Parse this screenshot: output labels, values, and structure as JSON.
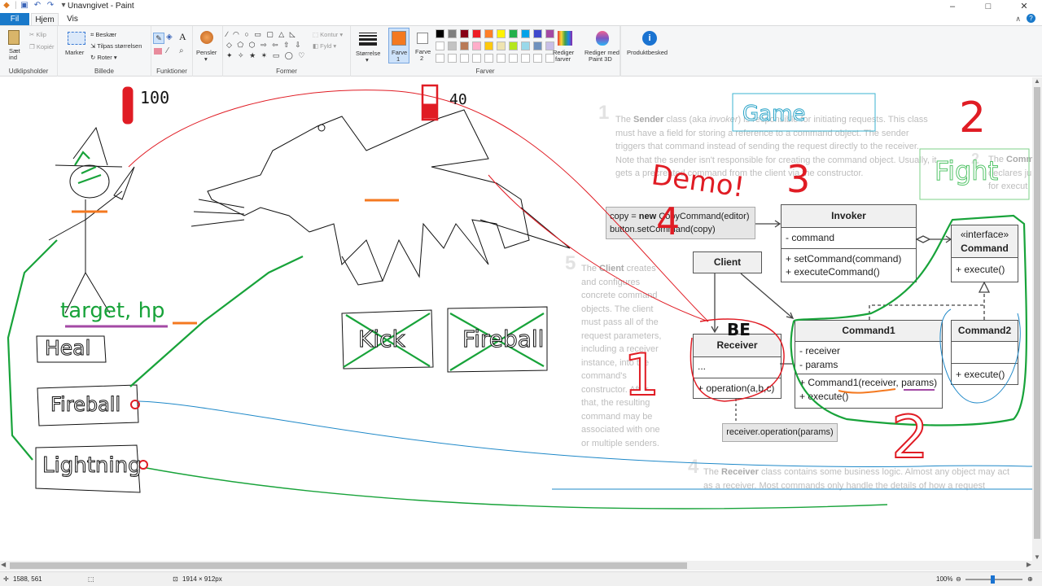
{
  "window": {
    "title": "Unavngivet - Paint",
    "minimize": "–",
    "maximize": "□",
    "close": "✕"
  },
  "tabs": [
    "Fil",
    "Hjem",
    "Vis"
  ],
  "ribbon": {
    "clipboard": {
      "paste": "Sæt",
      "paste2": "ind",
      "cut": "Klip",
      "copy": "Kopiér",
      "label": "Udklipsholder"
    },
    "image": {
      "select": "Marker",
      "crop": "Beskær",
      "resize": "Tilpas størrelsen",
      "rotate": "Roter",
      "label": "Billede"
    },
    "tools": {
      "label": "Funktioner"
    },
    "brushes": {
      "label": "Pensler"
    },
    "shapes": {
      "outline": "Kontur",
      "fill": "Fyld",
      "label": "Former"
    },
    "size": {
      "label": "Størrelse"
    },
    "color1": {
      "label": "Farve",
      "num": "1",
      "value": "#f47920"
    },
    "color2": {
      "label": "Farve",
      "num": "2",
      "value": "#ffffff"
    },
    "colors": {
      "label": "Farver",
      "row1": [
        "#000000",
        "#7f7f7f",
        "#880015",
        "#ed1c24",
        "#ff7f27",
        "#fff200",
        "#22b14c",
        "#00a2e8",
        "#3f48cc",
        "#a349a4"
      ],
      "row2": [
        "#ffffff",
        "#c3c3c3",
        "#b97a57",
        "#ffaec9",
        "#ffc90e",
        "#efe4b0",
        "#b5e61d",
        "#99d9ea",
        "#7092be",
        "#c8bfe7"
      ]
    },
    "editColors": "Rediger farver",
    "paint3d": "Rediger med Paint 3D",
    "product": "Produktbesked"
  },
  "status": {
    "cursor": "1588, 561",
    "size": "1914 × 912px",
    "zoom": "100%"
  },
  "canvas": {
    "hp_left": "100",
    "hp_right": "40",
    "target_hp": "target, hp",
    "heal": "Heal",
    "fireball": "Fireball",
    "lightning": "Lightning",
    "kick": "Kick",
    "fireball2": "Fireball",
    "game": "Game",
    "fight": "Fight",
    "demo": "Demo!",
    "demo_num": "4",
    "num3": "3",
    "num2_top": "2",
    "num1": "1",
    "num2_bottom": "2",
    "be": "BE"
  },
  "diagram": {
    "sender_text": {
      "num": "1",
      "bold": "Sender",
      "text1": " class (aka ",
      "italic": "invoker",
      "text2": ") is responsible for initiating requests. This class must have a field for storing a reference to a command object. The sender triggers that command instead of sending the request directly to the receiver. Note that the sender isn't responsible for creating the command object. Usually, it gets a precreated command from the client via the constructor.",
      "the": "The"
    },
    "command_text": {
      "num": "2",
      "lead": "The",
      "bold": "Comm",
      "line2": "declares ju",
      "line3": "for execut"
    },
    "client_text": {
      "num": "5",
      "lead": "The",
      "bold": "Client",
      "text": "creates and configures concrete command objects. The client must pass all of the request parameters, including a receiver instance, into the command's constructor. After that, the resulting command may be associated with one or multiple senders."
    },
    "receiver_text": {
      "num": "4",
      "lead": "The",
      "bold": "Receiver",
      "text": "class contains some business logic. Almost any object may act as a receiver. Most commands only handle the details of how a request"
    },
    "note_copy": {
      "line1a": "copy = ",
      "line1b": "new",
      "line1c": " CopyCommand(editor)",
      "line2": "button.setCommand(copy)"
    },
    "invoker": {
      "name": "Invoker",
      "field": "- command",
      "m1": "+ setCommand(command)",
      "m2": "+ executeCommand()"
    },
    "command_iface": {
      "stereo": "«interface»",
      "name": "Command",
      "m1": "+ execute()"
    },
    "client": {
      "name": "Client"
    },
    "receiver": {
      "name": "Receiver",
      "field": "...",
      "m1": "+ operation(a,b,c)"
    },
    "command1": {
      "name": "Command1",
      "f1": "- receiver",
      "f2": "- params",
      "m1a": "+ Command1(",
      "m1b": "receiver",
      "m1c": ", ",
      "m1d": "params",
      "m1e": ")",
      "m2": "+ execute()"
    },
    "command2": {
      "name": "Command2",
      "m1": "+ execute()"
    },
    "note_receiver": "receiver.operation(params)"
  }
}
